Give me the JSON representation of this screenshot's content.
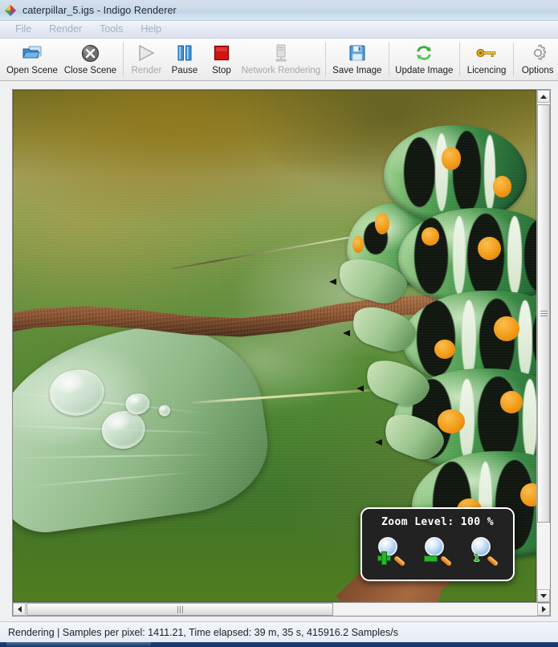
{
  "window": {
    "title": "caterpillar_5.igs - Indigo Renderer",
    "app_icon": "indigo-diamond-icon"
  },
  "menu": {
    "items": [
      {
        "label": "File"
      },
      {
        "label": "Render"
      },
      {
        "label": "Tools"
      },
      {
        "label": "Help"
      }
    ]
  },
  "toolbar": {
    "buttons": [
      {
        "label": "Open Scene",
        "icon": "folder-open-icon",
        "enabled": true
      },
      {
        "label": "Close Scene",
        "icon": "close-circle-icon",
        "enabled": true
      },
      {
        "label": "Render",
        "icon": "play-triangle-icon",
        "enabled": false
      },
      {
        "label": "Pause",
        "icon": "pause-bars-icon",
        "enabled": true
      },
      {
        "label": "Stop",
        "icon": "stop-square-icon",
        "enabled": true
      },
      {
        "label": "Network Rendering",
        "icon": "server-tower-icon",
        "enabled": false
      },
      {
        "label": "Save Image",
        "icon": "floppy-disk-icon",
        "enabled": true
      },
      {
        "label": "Update Image",
        "icon": "refresh-arrows-icon",
        "enabled": true
      },
      {
        "label": "Licencing",
        "icon": "key-icon",
        "enabled": true
      },
      {
        "label": "Options",
        "icon": "gear-icon",
        "enabled": true
      }
    ]
  },
  "zoom_panel": {
    "title": "Zoom Level: 100 %",
    "level_percent": 100,
    "buttons": [
      {
        "name": "zoom-in",
        "icon": "magnifier-plus-icon",
        "badge": "+"
      },
      {
        "name": "zoom-out",
        "icon": "magnifier-minus-icon",
        "badge": "−"
      },
      {
        "name": "zoom-actual",
        "icon": "magnifier-one-icon",
        "badge": "1"
      }
    ]
  },
  "render_view": {
    "subject": "green caterpillar on a brown twig with a dew-covered leaf",
    "background": "blurred green and olive foliage"
  },
  "scrollbars": {
    "vertical": {
      "up_arrow": "triangle-up-icon",
      "down_arrow": "triangle-down-icon"
    },
    "horizontal": {
      "left_arrow": "triangle-left-icon",
      "right_arrow": "triangle-right-icon"
    }
  },
  "status_bar": {
    "text": "Rendering | Samples per pixel: 1411.21, Time elapsed: 39 m, 35 s, 415916.2 Samples/s",
    "state": "Rendering",
    "samples_per_pixel": "1411.21",
    "time_elapsed": "39 m, 35 s",
    "samples_per_second": "415916.2 Samples/s"
  },
  "colors": {
    "title_bar": "#cbdbe9",
    "menu_bar": "#dde3f1",
    "toolbar": "#f3f3f3",
    "status_bar": "#e6ecf4",
    "accent_blue": "#2f74c0",
    "stop_red": "#cc1111",
    "pause_blue": "#2f7fd0",
    "zoom_badge_green": "#2bb32b",
    "taskbar": "#1b3f7d"
  }
}
